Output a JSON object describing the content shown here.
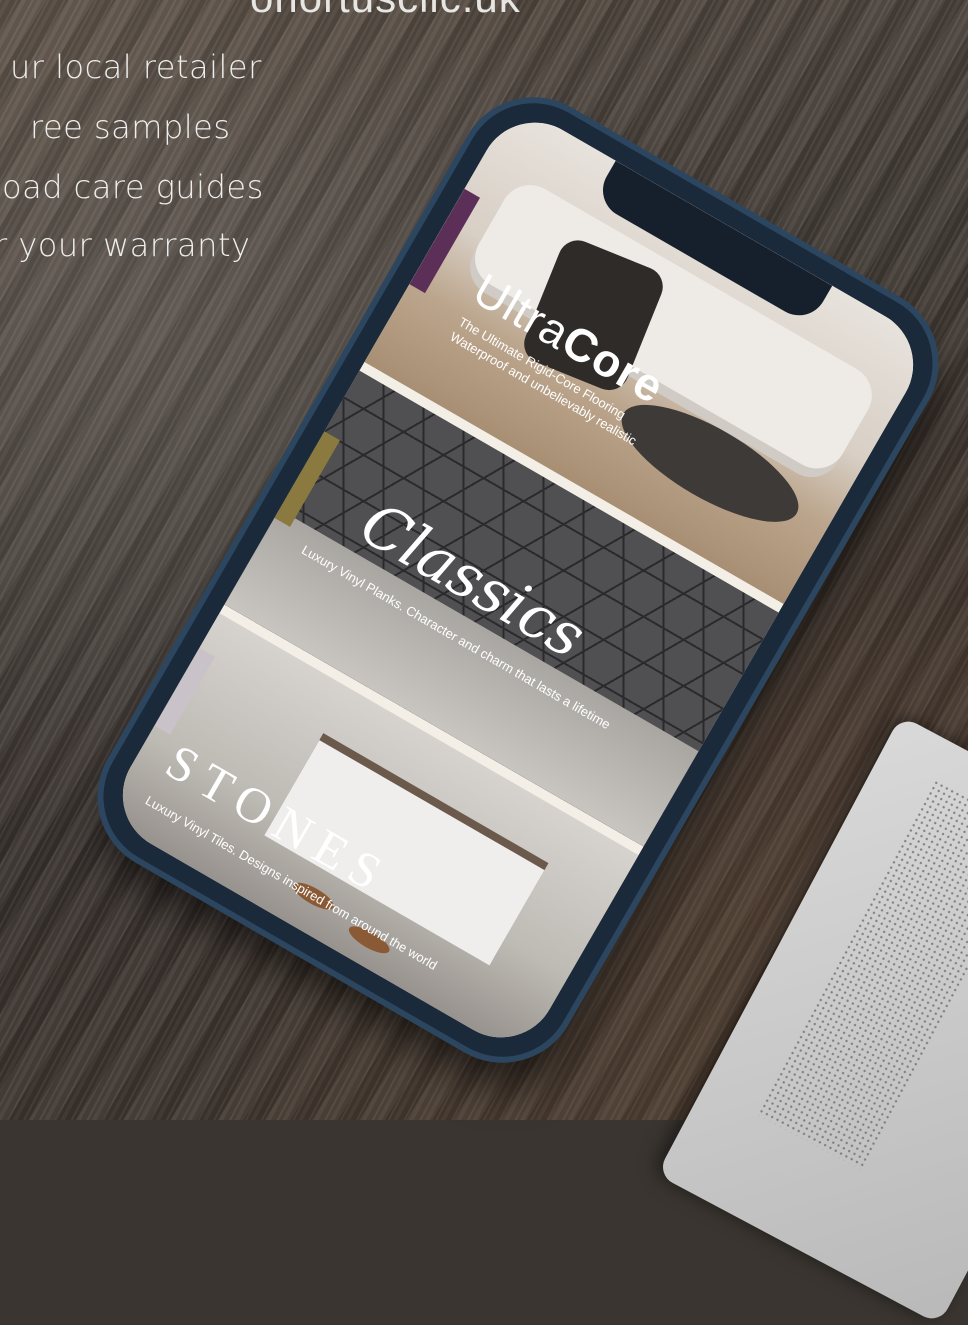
{
  "page": {
    "tagline_partial": "onortusclic.uk"
  },
  "bullets": [
    "ur local retailer",
    "ree samples",
    "oad care guides",
    "r your warranty"
  ],
  "phone": {
    "panels": [
      {
        "title_light": "Ultra",
        "title_bold": "Core",
        "subtitle_line1": "The Ultimate Rigid-Core Flooring",
        "subtitle_line2": "Waterproof and unbelievably realistic",
        "accent_color": "#5b2f58"
      },
      {
        "title": "Classics",
        "subtitle": "Luxury Vinyl Planks. Character and charm that lasts a lifetime",
        "accent_color": "#8a7a3f"
      },
      {
        "title": "STONES",
        "subtitle": "Luxury Vinyl Tiles. Designs inspired from around the world",
        "accent_color": "#c9c2c8"
      }
    ]
  }
}
